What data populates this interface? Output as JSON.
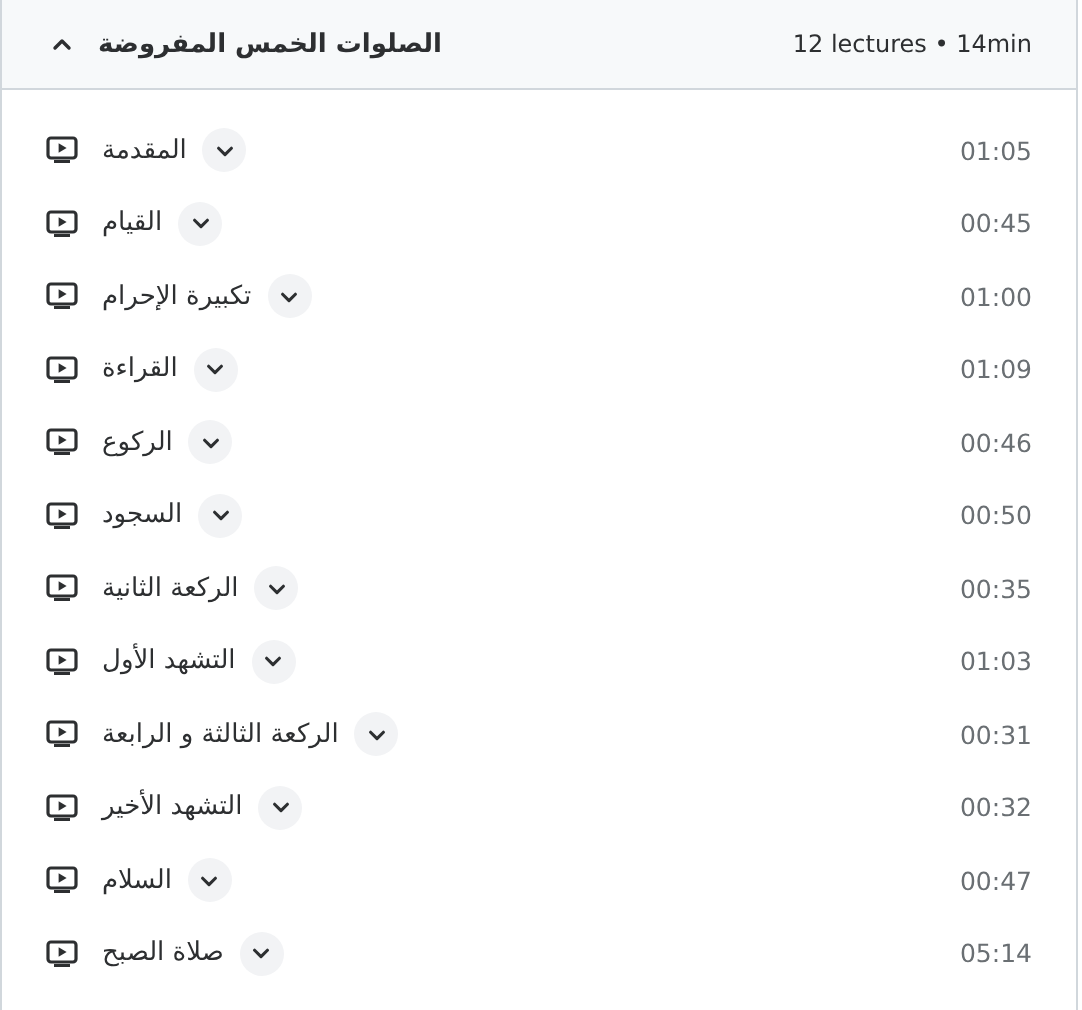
{
  "section": {
    "title": "الصلوات الخمس المفروضة",
    "meta": "12 lectures • 14min",
    "expanded": true
  },
  "lectures": [
    {
      "title": "المقدمة",
      "duration": "01:05",
      "expanded": false
    },
    {
      "title": "القيام",
      "duration": "00:45",
      "expanded": false
    },
    {
      "title": "تكبيرة الإحرام",
      "duration": "01:00",
      "expanded": false
    },
    {
      "title": "القراءة",
      "duration": "01:09",
      "expanded": false
    },
    {
      "title": "الركوع",
      "duration": "00:46",
      "expanded": false
    },
    {
      "title": "السجود",
      "duration": "00:50",
      "expanded": false
    },
    {
      "title": "الركعة الثانية",
      "duration": "00:35",
      "expanded": false
    },
    {
      "title": "التشهد الأول",
      "duration": "01:03",
      "expanded": false
    },
    {
      "title": "الركعة الثالثة و الرابعة",
      "duration": "00:31",
      "expanded": false
    },
    {
      "title": "التشهد الأخير",
      "duration": "00:32",
      "expanded": false
    },
    {
      "title": "السلام",
      "duration": "00:47",
      "expanded": false
    },
    {
      "title": "صلاة الصبح",
      "duration": "05:14",
      "expanded": false
    }
  ]
}
